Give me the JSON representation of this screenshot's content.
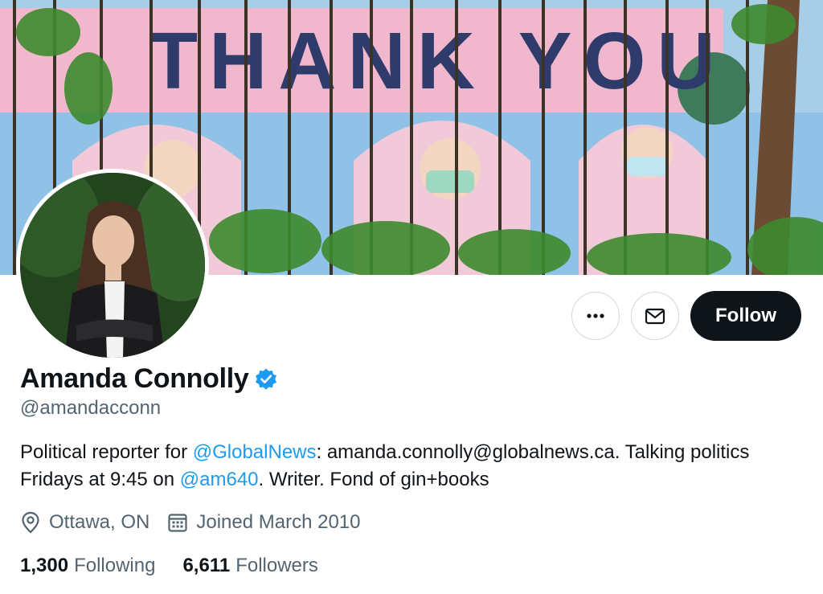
{
  "banner": {
    "mural_text": "THANK YOU"
  },
  "profile": {
    "name": "Amanda Connolly",
    "handle": "@amandacconn",
    "verified_color": "#1d9bf0"
  },
  "bio": {
    "part1": "Political reporter for ",
    "mention1": "@GlobalNews",
    "part2": ": amanda.connolly@globalnews.ca. Talking politics Fridays at 9:45 on ",
    "mention2": "@am640",
    "part3": ". Writer. Fond of gin+books"
  },
  "meta": {
    "location": "Ottawa, ON",
    "location_icon": "map-pin-icon",
    "joined": "Joined March 2010",
    "joined_icon": "calendar-icon"
  },
  "actions": {
    "more_icon": "more-icon",
    "message_icon": "envelope-icon",
    "follow_label": "Follow"
  },
  "stats": {
    "following_count": "1,300",
    "following_label": "Following",
    "followers_count": "6,611",
    "followers_label": "Followers"
  },
  "colors": {
    "accent": "#1d9bf0",
    "text": "#0f1419",
    "secondary": "#536471",
    "button": "#0f1419"
  }
}
